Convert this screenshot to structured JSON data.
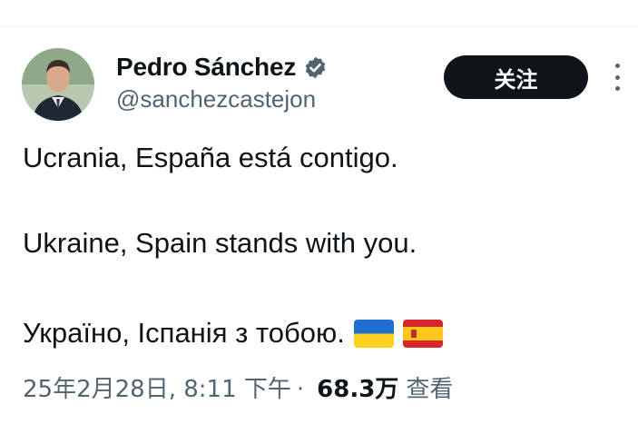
{
  "author": {
    "display_name": "Pedro Sánchez",
    "handle": "@sanchezcastejon",
    "verified": true,
    "verified_color": "#1d9bf0"
  },
  "follow_button": {
    "label": "关注"
  },
  "tweet": {
    "line_es": "Ucrania, España está contigo.",
    "line_en": "Ukraine, Spain stands with you.",
    "line_uk": "Україно, Іспанія з тобою.",
    "flags": [
      "ukraine-flag",
      "spain-flag"
    ]
  },
  "meta": {
    "timestamp": "25年2月28日, 8:11 下午",
    "separator": "·",
    "views_count": "68.3万",
    "views_label": "查看"
  },
  "icons": {
    "more": "more-vertical-icon",
    "verified": "verified-badge-icon"
  }
}
